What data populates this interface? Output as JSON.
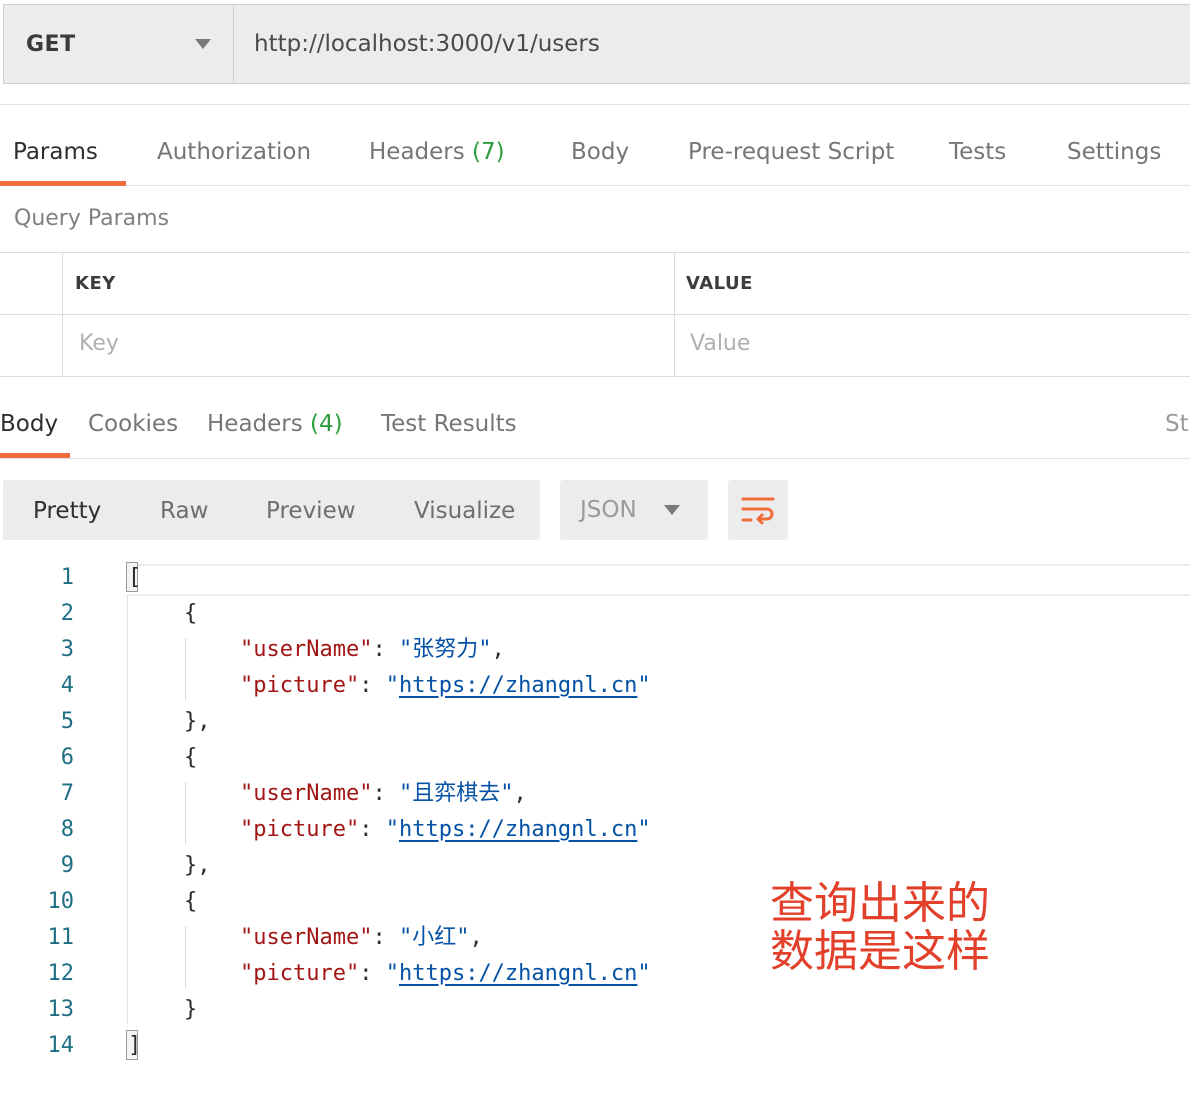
{
  "request": {
    "method": "GET",
    "url": "http://localhost:3000/v1/users"
  },
  "request_tabs": [
    {
      "label": "Params",
      "count": ""
    },
    {
      "label": "Authorization",
      "count": ""
    },
    {
      "label": "Headers",
      "count": "(7)"
    },
    {
      "label": "Body",
      "count": ""
    },
    {
      "label": "Pre-request Script",
      "count": ""
    },
    {
      "label": "Tests",
      "count": ""
    },
    {
      "label": "Settings",
      "count": ""
    }
  ],
  "query_params": {
    "title": "Query Params",
    "col_key": "KEY",
    "col_value": "VALUE",
    "key_placeholder": "Key",
    "value_placeholder": "Value"
  },
  "response_tabs": [
    {
      "label": "Body",
      "count": ""
    },
    {
      "label": "Cookies",
      "count": ""
    },
    {
      "label": "Headers",
      "count": "(4)"
    },
    {
      "label": "Test Results",
      "count": ""
    }
  ],
  "response_status_partial": "Sta",
  "view_modes": [
    "Pretty",
    "Raw",
    "Preview",
    "Visualize"
  ],
  "format": "JSON",
  "icons": {
    "method_caret": "chevron-down-icon",
    "format_caret": "chevron-down-icon",
    "wrap": "wrap-lines-icon"
  },
  "colors": {
    "accent": "#f26b3a",
    "count": "#2d9c3e",
    "annotation": "#e2402a"
  },
  "code_lines": [
    "1",
    "2",
    "3",
    "4",
    "5",
    "6",
    "7",
    "8",
    "9",
    "10",
    "11",
    "12",
    "13",
    "14"
  ],
  "json_body": {
    "open_bracket": "[",
    "close_bracket": "]",
    "open_brace": "{",
    "close_brace": "}",
    "close_brace_comma": "},",
    "key_username": "\"userName\"",
    "key_picture": "\"picture\"",
    "colon": ": ",
    "comma": ",",
    "quote": "\"",
    "users": [
      {
        "userName": "\"张努力\"",
        "picture": "https://zhangnl.cn"
      },
      {
        "userName": "\"且弈棋去\"",
        "picture": "https://zhangnl.cn"
      },
      {
        "userName": "\"小红\"",
        "picture": "https://zhangnl.cn"
      }
    ]
  },
  "annotation": "查询出来的\n数据是这样"
}
